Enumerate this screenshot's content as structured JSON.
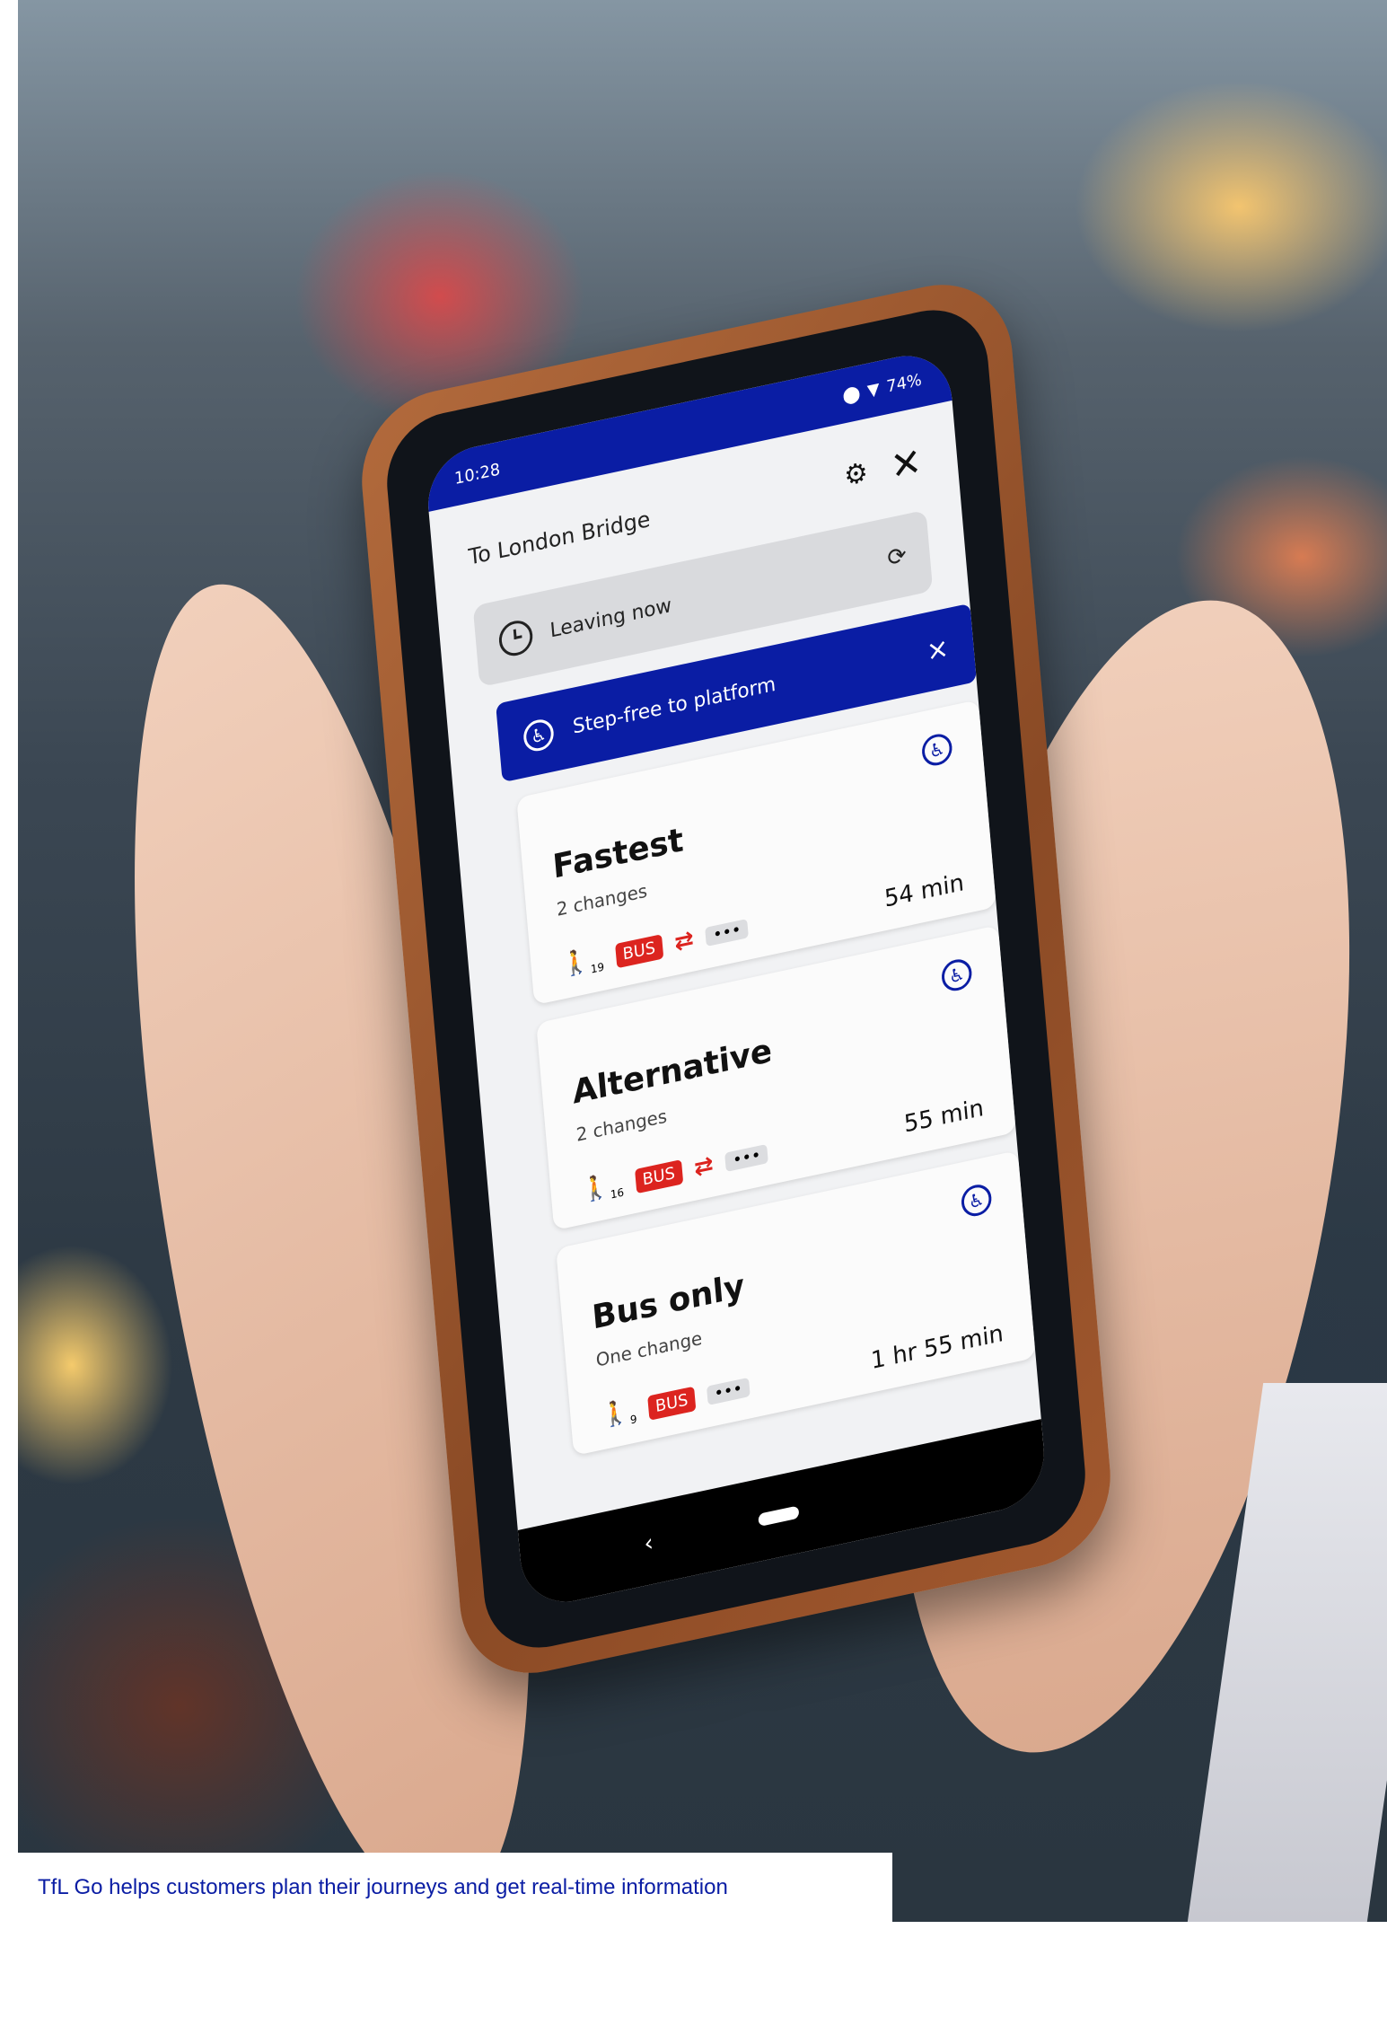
{
  "status": {
    "time": "10:28",
    "battery": "74%"
  },
  "header": {
    "destination": "To London Bridge",
    "filter_icon": "filter-icon",
    "close_icon": "close-icon"
  },
  "leaving": {
    "label": "Leaving now",
    "icon": "clock-icon",
    "refresh_icon": "refresh-icon"
  },
  "stepfree": {
    "label": "Step-free to platform",
    "icon": "wheelchair-icon",
    "dismiss": "×"
  },
  "routes": [
    {
      "title": "Fastest",
      "subtitle": "2 changes",
      "walk": "19",
      "bus": "BUS",
      "duration": "54 min"
    },
    {
      "title": "Alternative",
      "subtitle": "2 changes",
      "walk": "16",
      "bus": "BUS",
      "duration": "55 min"
    },
    {
      "title": "Bus only",
      "subtitle": "One change",
      "walk": "9",
      "bus": "BUS",
      "duration": "1 hr 55 min"
    }
  ],
  "caption": "TfL Go helps customers plan their journeys and get real-time information",
  "colors": {
    "tfl_blue": "#0a1da4",
    "bus_red": "#dc241f"
  }
}
